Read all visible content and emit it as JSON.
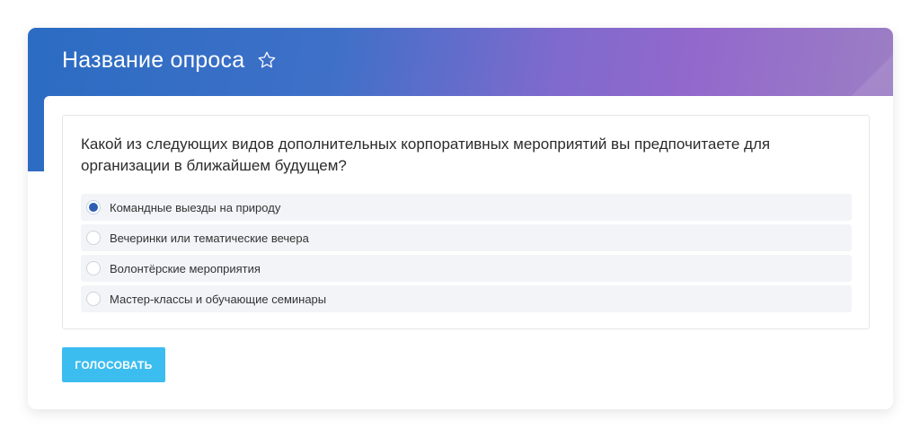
{
  "poll": {
    "title": "Название опроса",
    "question": "Какой из следующих видов дополнительных корпоративных мероприятий вы предпочитаете для организации в ближайшем будущем?",
    "options": [
      {
        "label": "Командные выезды на природу",
        "selected": true
      },
      {
        "label": "Вечеринки или тематические вечера",
        "selected": false
      },
      {
        "label": "Волонтёрские мероприятия",
        "selected": false
      },
      {
        "label": "Мастер-классы и обучающие семинары",
        "selected": false
      }
    ],
    "vote_label": "ГОЛОСОВАТЬ"
  },
  "icons": {
    "favorite": "star-outline-icon"
  },
  "colors": {
    "header_gradient_start": "#2b6cc2",
    "header_gradient_mid": "#7f6acd",
    "header_gradient_end": "#9c7fc4",
    "radio_selected": "#2e5eb3",
    "vote_button": "#3cbdf0",
    "option_background": "#f2f4f7"
  }
}
